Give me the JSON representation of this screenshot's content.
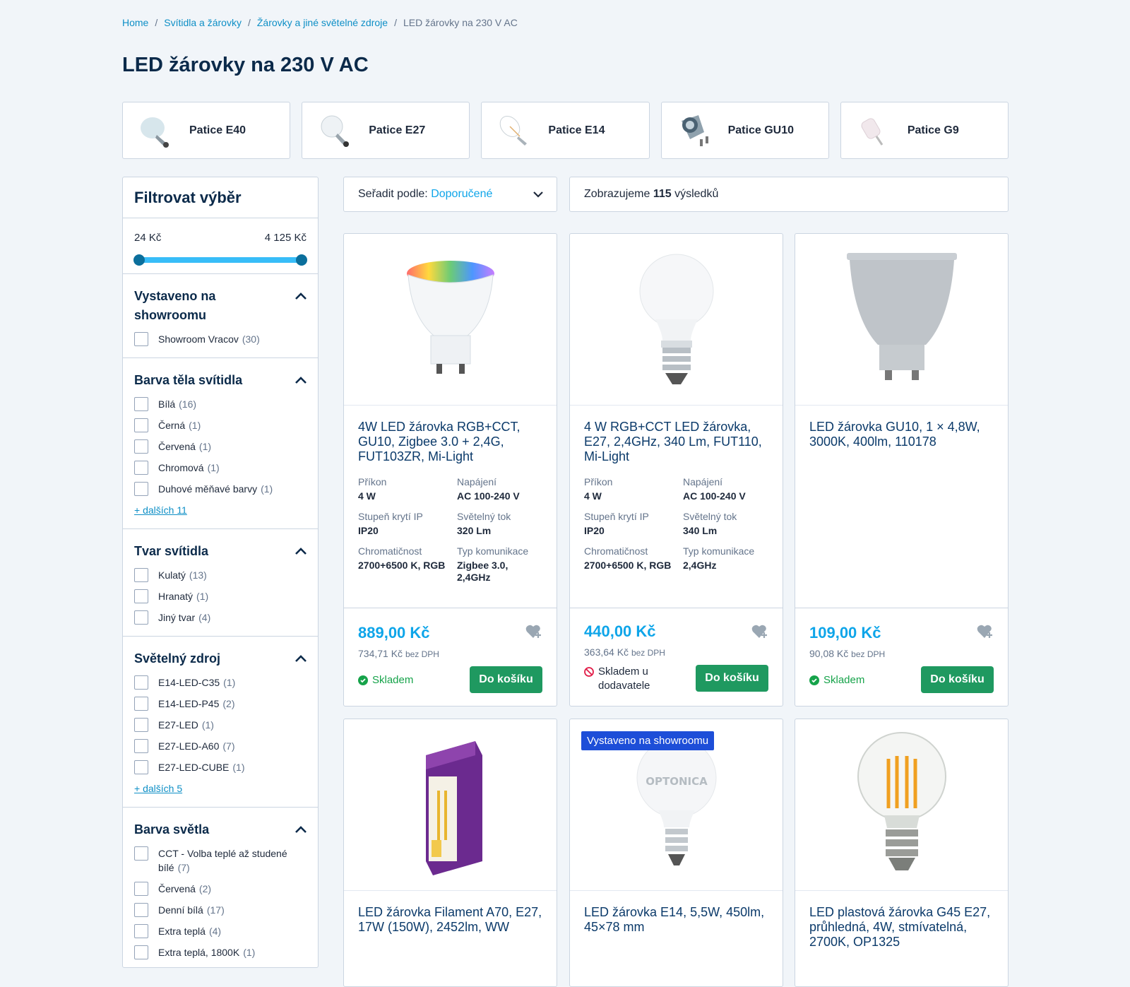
{
  "breadcrumb": {
    "items": [
      "Home",
      "Svítidla a žárovky",
      "Žárovky a jiné světelné zdroje"
    ],
    "current": "LED žárovky na 230 V AC"
  },
  "page_title": "LED žárovky na 230 V AC",
  "categories": [
    "Patice E40",
    "Patice E27",
    "Patice E14",
    "Patice GU10",
    "Patice G9"
  ],
  "filter": {
    "title": "Filtrovat výběr",
    "price_min": "24 Kč",
    "price_max": "4 125 Kč",
    "sections": [
      {
        "title": "Vystaveno na showroomu",
        "options": [
          {
            "label": "Showroom Vracov",
            "count": "(30)"
          }
        ]
      },
      {
        "title": "Barva těla svítidla",
        "options": [
          {
            "label": "Bílá",
            "count": "(16)"
          },
          {
            "label": "Černá",
            "count": "(1)"
          },
          {
            "label": "Červená",
            "count": "(1)"
          },
          {
            "label": "Chromová",
            "count": "(1)"
          },
          {
            "label": "Duhové měňavé barvy",
            "count": "(1)"
          }
        ],
        "more": "+ dalších 11"
      },
      {
        "title": "Tvar svítidla",
        "options": [
          {
            "label": "Kulatý",
            "count": "(13)"
          },
          {
            "label": "Hranatý",
            "count": "(1)"
          },
          {
            "label": "Jiný tvar",
            "count": "(4)"
          }
        ]
      },
      {
        "title": "Světelný zdroj",
        "options": [
          {
            "label": "E14-LED-C35",
            "count": "(1)"
          },
          {
            "label": "E14-LED-P45",
            "count": "(2)"
          },
          {
            "label": "E27-LED",
            "count": "(1)"
          },
          {
            "label": "E27-LED-A60",
            "count": "(7)"
          },
          {
            "label": "E27-LED-CUBE",
            "count": "(1)"
          }
        ],
        "more": "+ dalších 5"
      },
      {
        "title": "Barva světla",
        "options": [
          {
            "label": "CCT - Volba teplé až studené bílé",
            "count": "(7)"
          },
          {
            "label": "Červená",
            "count": "(2)"
          },
          {
            "label": "Denní bílá",
            "count": "(17)"
          },
          {
            "label": "Extra teplá",
            "count": "(4)"
          },
          {
            "label": "Extra teplá, 1800K",
            "count": "(1)"
          }
        ]
      }
    ]
  },
  "sort": {
    "label": "Seřadit podle:",
    "value": "Doporučené"
  },
  "results": {
    "prefix": "Zobrazujeme",
    "count": "115",
    "suffix": "výsledků"
  },
  "products": [
    {
      "name": "4W LED žárovka RGB+CCT, GU10, Zigbee 3.0 + 2,4G, FUT103ZR, Mi-Light",
      "specs": [
        {
          "k": "Příkon",
          "v": "4 W"
        },
        {
          "k": "Napájení",
          "v": "AC 100-240 V"
        },
        {
          "k": "Stupeň krytí IP",
          "v": "IP20"
        },
        {
          "k": "Světelný tok",
          "v": "320 Lm"
        },
        {
          "k": "Chromatičnost",
          "v": "2700+6500 K, RGB"
        },
        {
          "k": "Typ komunikace",
          "v": "Zigbee 3.0, 2,4GHz"
        }
      ],
      "price": "889,00 Kč",
      "price_net": "734,71 Kč",
      "net_label": "bez DPH",
      "stock": "Skladem",
      "stock_ok": true,
      "button": "Do košíku"
    },
    {
      "name": "4 W RGB+CCT LED žárovka, E27, 2,4GHz, 340 Lm, FUT110, Mi-Light",
      "specs": [
        {
          "k": "Příkon",
          "v": "4 W"
        },
        {
          "k": "Napájení",
          "v": "AC 100-240 V"
        },
        {
          "k": "Stupeň krytí IP",
          "v": "IP20"
        },
        {
          "k": "Světelný tok",
          "v": "340 Lm"
        },
        {
          "k": "Chromatičnost",
          "v": "2700+6500 K, RGB"
        },
        {
          "k": "Typ komunikace",
          "v": "2,4GHz"
        }
      ],
      "price": "440,00 Kč",
      "price_net": "363,64 Kč",
      "net_label": "bez DPH",
      "stock": "Skladem u dodavatele",
      "stock_ok": false,
      "button": "Do košíku"
    },
    {
      "name": "LED žárovka GU10, 1 × 4,8W, 3000K, 400lm, 110178",
      "specs": [],
      "price": "109,00 Kč",
      "price_net": "90,08 Kč",
      "net_label": "bez DPH",
      "stock": "Skladem",
      "stock_ok": true,
      "button": "Do košíku"
    },
    {
      "name": "LED žárovka Filament A70, E27, 17W (150W), 2452lm, WW"
    },
    {
      "name": "LED žárovka E14, 5,5W, 450lm, 45×78 mm",
      "badge": "Vystaveno na showroomu"
    },
    {
      "name": "LED plastová žárovka G45 E27, průhledná, 4W, stmívatelná, 2700K, OP1325"
    }
  ],
  "colors": {
    "accent": "#0ea5e9",
    "link": "#0e8fc6",
    "button": "#1f9960",
    "badge": "#1d4ed8",
    "title": "#0b2a4a"
  }
}
